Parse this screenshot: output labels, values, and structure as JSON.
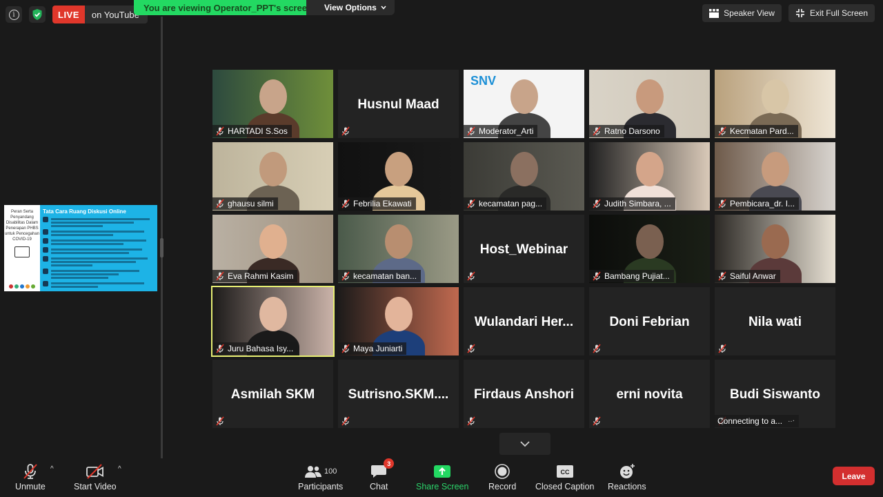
{
  "top": {
    "live_badge": "LIVE",
    "live_destination": "on YouTube",
    "viewing_banner": "You are viewing Operator_PPT's screen",
    "view_options": "View Options",
    "speaker_view": "Speaker View",
    "exit_full_screen": "Exit Full Screen"
  },
  "slide": {
    "left_text": "Peran Serta Penyandang Disabilitas Dalam Penerapan PHBS untuk Pencegahan COVID-19",
    "title": "Tata Cara Ruang Diskusi Online"
  },
  "tiles": [
    {
      "name": "HARTADI S.Sos",
      "video": true
    },
    {
      "name": "Husnul Maad",
      "video": false
    },
    {
      "name": "Moderator_Arti",
      "video": true,
      "brand": "SNV"
    },
    {
      "name": "Ratno Darsono",
      "video": true
    },
    {
      "name": "Kecmatan Pard...",
      "video": true
    },
    {
      "name": "ghausu silmi",
      "video": true
    },
    {
      "name": "Febrilia Ekawati",
      "video": true
    },
    {
      "name": "kecamatan pag...",
      "video": true
    },
    {
      "name": "Judith Simbara, ...",
      "video": true
    },
    {
      "name": "Pembicara_dr. I...",
      "video": true
    },
    {
      "name": "Eva Rahmi Kasim",
      "video": true
    },
    {
      "name": "kecamatan ban...",
      "video": true
    },
    {
      "name": "Host_Webinar",
      "video": false
    },
    {
      "name": "Bambang Pujiat...",
      "video": true
    },
    {
      "name": "Saiful Anwar",
      "video": true
    },
    {
      "name": "Juru Bahasa Isy...",
      "video": true,
      "active": true
    },
    {
      "name": "Maya Juniarti",
      "video": true
    },
    {
      "name": "Wulandari  Her...",
      "video": false
    },
    {
      "name": "Doni Febrian",
      "video": false
    },
    {
      "name": "Nila wati",
      "video": false
    },
    {
      "name": "Asmilah SKM",
      "video": false
    },
    {
      "name": "Sutrisno.SKM....",
      "video": false
    },
    {
      "name": "Firdaus Anshori",
      "video": false
    },
    {
      "name": "erni novita",
      "video": false
    },
    {
      "name": "Budi Siswanto",
      "video": false,
      "status": "Connecting to a..."
    }
  ],
  "toolbar": {
    "unmute": "Unmute",
    "start_video": "Start Video",
    "participants": "Participants",
    "participants_count": "100",
    "chat": "Chat",
    "chat_badge": "3",
    "share_screen": "Share Screen",
    "record": "Record",
    "closed_caption": "Closed Caption",
    "reactions": "Reactions",
    "leave": "Leave"
  },
  "colors": {
    "live": "#e0372b",
    "share": "#23d962",
    "active_speaker": "#e7ef73",
    "leave": "#d32f2f"
  }
}
